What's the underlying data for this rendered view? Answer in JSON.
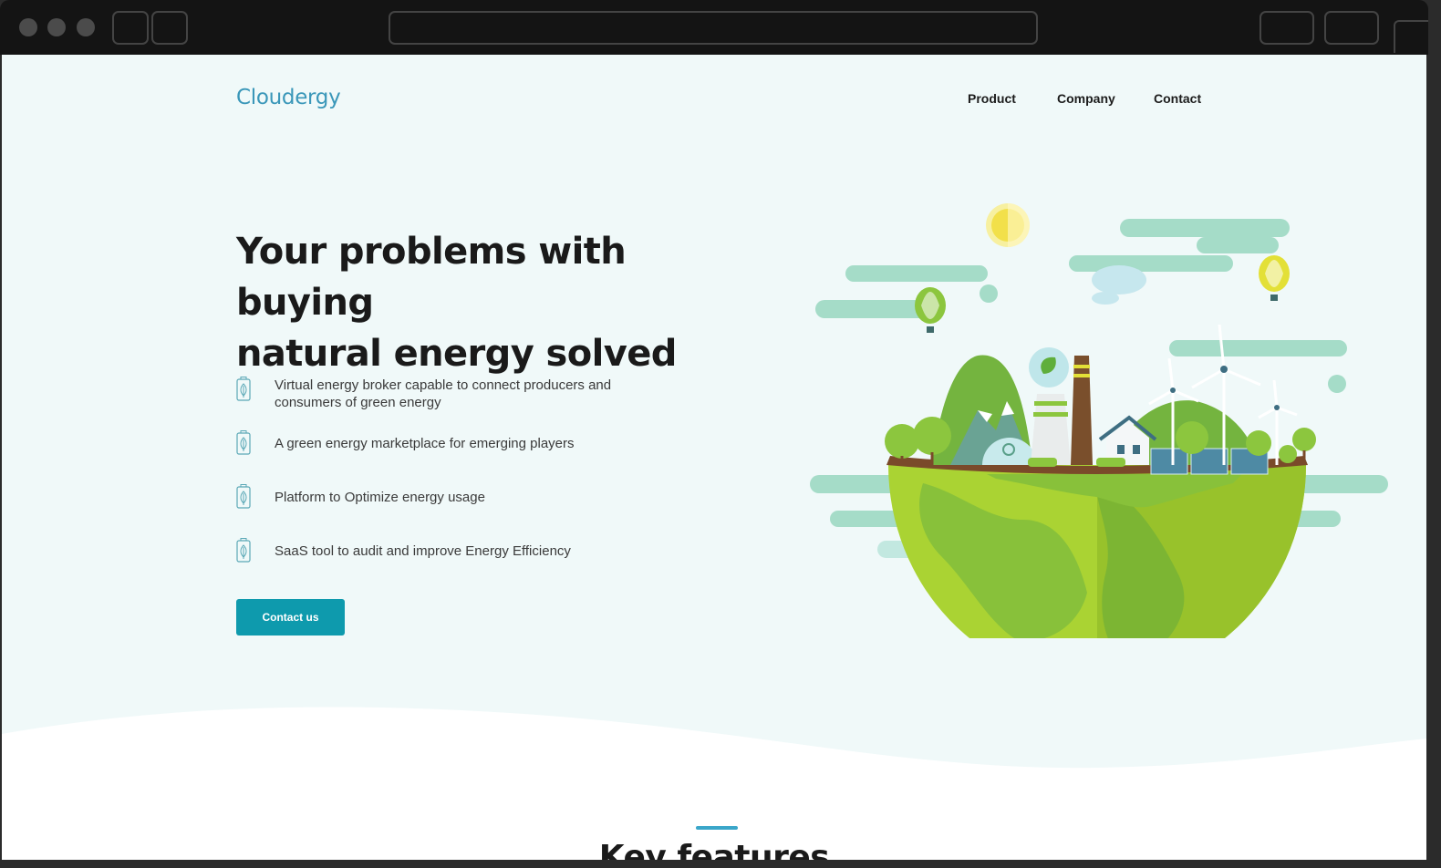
{
  "site": {
    "logo": "Cloudergy",
    "nav": [
      "Product",
      "Company",
      "Contact"
    ]
  },
  "hero": {
    "title_line1": "Your problems with buying",
    "title_line2": "natural energy solved",
    "features": [
      "Virtual energy broker capable to connect producers and consumers of green energy",
      "A green energy marketplace for emerging players",
      "Platform to Optimize energy usage",
      "SaaS tool to audit and improve Energy Efficiency"
    ],
    "cta": "Contact us"
  },
  "section": {
    "title": "Key features"
  },
  "colors": {
    "brand": "#3a97b9",
    "button": "#0e9aad",
    "background": "#f0f9f9"
  }
}
